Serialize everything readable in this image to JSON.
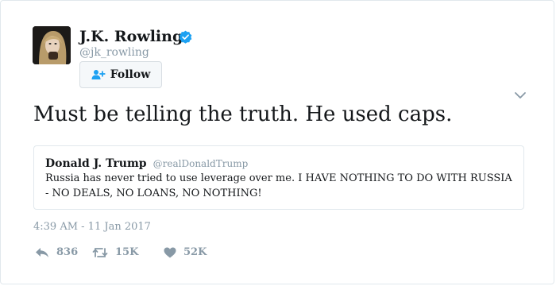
{
  "author": {
    "name": "J.K. Rowling",
    "handle": "@jk_rowling",
    "verified": true
  },
  "follow_button": {
    "label": "Follow",
    "icon": "add-user-icon"
  },
  "tweet": {
    "text": "Must be telling the truth. He used caps.",
    "timestamp": "4:39 AM - 11 Jan 2017"
  },
  "quoted_tweet": {
    "name": "Donald J. Trump",
    "handle": "@realDonaldTrump",
    "text": "Russia has never tried to use leverage over me. I HAVE NOTHING TO DO WITH RUSSIA - NO DEALS, NO LOANS, NO NOTHING!"
  },
  "actions": {
    "replies": "836",
    "retweets": "15K",
    "likes": "52K"
  },
  "colors": {
    "verified": "#1da1f2",
    "follow_icon": "#1da1f2",
    "muted": "#8899a6",
    "border": "#e1e8ed"
  }
}
